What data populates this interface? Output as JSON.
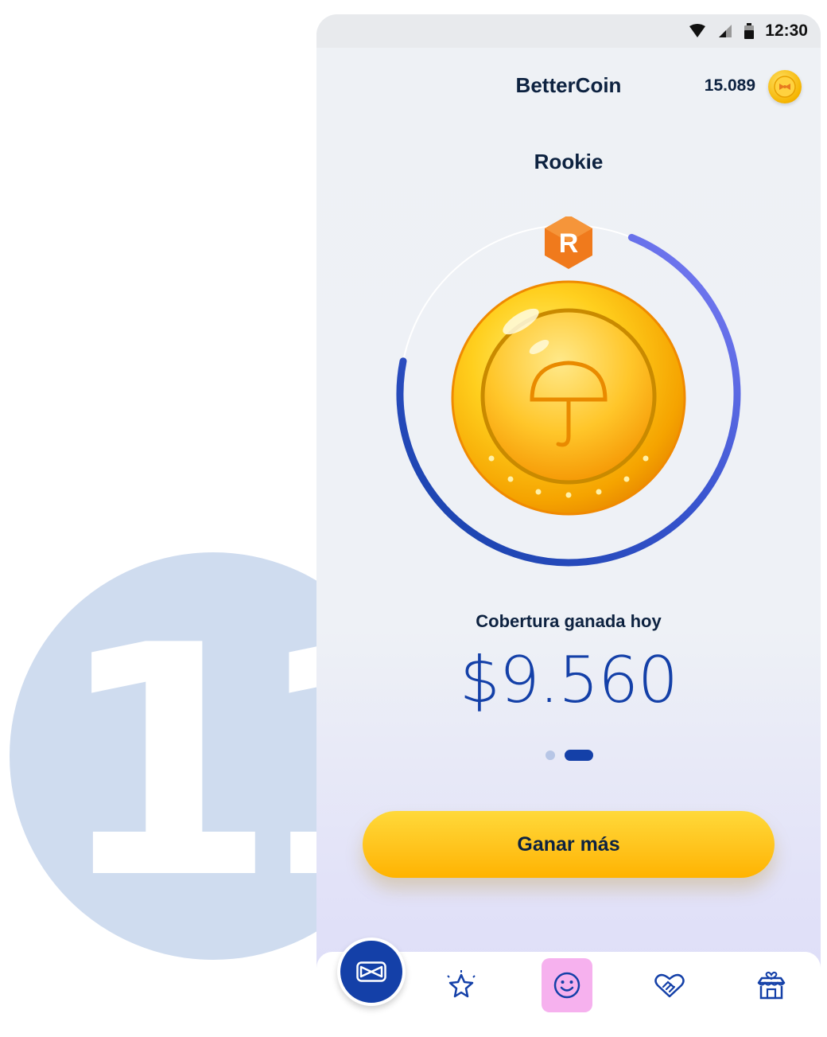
{
  "step_number": "11",
  "status_bar": {
    "time": "12:30"
  },
  "header": {
    "title": "BetterCoin",
    "coin_balance": "15.089"
  },
  "level": {
    "name": "Rookie",
    "badge_letter": "R",
    "progress": 0.72
  },
  "coverage": {
    "label": "Cobertura ganada hoy",
    "value": "$9.560"
  },
  "pager": {
    "count": 2,
    "active": 1
  },
  "cta": {
    "label": "Ganar más"
  },
  "nav": {
    "items": [
      {
        "icon": "bowtie-logo-icon",
        "active": false
      },
      {
        "icon": "star-icon",
        "active": false
      },
      {
        "icon": "smiley-icon",
        "active": true
      },
      {
        "icon": "heart-handshake-icon",
        "active": false
      },
      {
        "icon": "store-icon",
        "active": false
      }
    ]
  },
  "colors": {
    "primary": "#1440a8",
    "ring_gradient_end": "#7b7bf5",
    "cta_yellow": "#ffc21a",
    "badge_orange": "#f07a1c",
    "active_nav": "#f6b1ee"
  }
}
